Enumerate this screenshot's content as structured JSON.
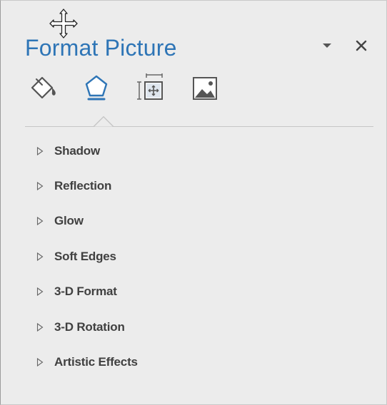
{
  "pane": {
    "title": "Format Picture",
    "icons": {
      "move": "move-cursor-icon",
      "dropdown": "chevron-down-icon",
      "close": "close-icon"
    },
    "tabs": [
      {
        "icon": "fill-line-icon",
        "selected": false
      },
      {
        "icon": "effects-pentagon-icon",
        "selected": true
      },
      {
        "icon": "size-properties-icon",
        "selected": false
      },
      {
        "icon": "picture-icon",
        "selected": false
      }
    ],
    "sections": [
      {
        "label": "Shadow"
      },
      {
        "label": "Reflection"
      },
      {
        "label": "Glow"
      },
      {
        "label": "Soft Edges"
      },
      {
        "label": "3-D Format"
      },
      {
        "label": "3-D Rotation"
      },
      {
        "label": "Artistic Effects"
      }
    ]
  },
  "colors": {
    "accent": "#2e75b6",
    "background": "#ececec",
    "text": "#404040"
  }
}
